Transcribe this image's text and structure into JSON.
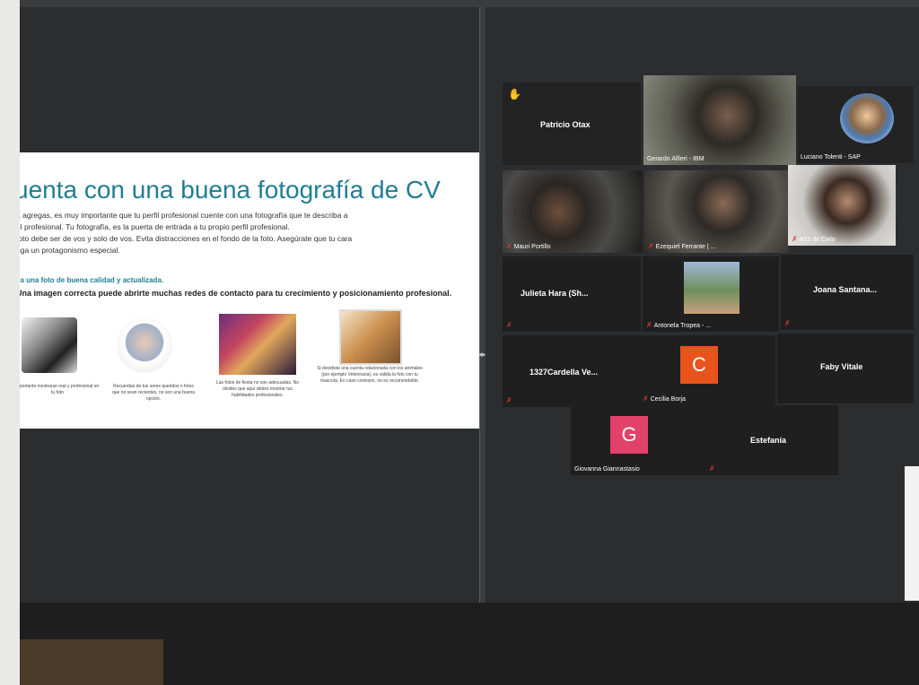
{
  "slide": {
    "title": "uenta con una buena fotografía de CV",
    "body_lines": [
      "a agregas, es muy importante que tu perfil profesional cuente con una fotografía que te describa a",
      "el profesional. Tu fotografía, es la puerta de entrada a tu propio perfil profesional.",
      "foto debe ser de vos y solo de vos. Evita distracciones en el fondo de la foto. Asegúrate que tu cara",
      "nga un protagonismo especial."
    ],
    "subheading": "sa una foto de buena calidad y actualizada.",
    "bold_line": "Una imagen correcta puede abrirte muchas redes de contacto para tu crecimiento y posicionamiento profesional.",
    "captions": [
      "mportante mostrarse real y profesional en tu foto",
      "Recuerdas de tus seres queridos o fotos que no sean recientes, no son una buena opción.",
      "Las fotos de fiesta no son adecuadas. No olvides que aquí debes mostrar tus habilidades profesionales.",
      "Si decidiste una cuenta relacionada con los animales (por ejemplo Veterinaria), es válida la foto con tu mascota. En caso contrario, no es recomendable."
    ]
  },
  "participants": [
    {
      "name": "Patricio Otax",
      "kind": "name-only",
      "hand": true
    },
    {
      "name": "Gerardo Alfieri - IBM",
      "kind": "video",
      "active": true
    },
    {
      "name": "Luciano Tolenti - SAP",
      "kind": "video"
    },
    {
      "name": "Mauri Portillo",
      "kind": "video",
      "muted": true
    },
    {
      "name": "Ezequiel Ferrante | ...",
      "kind": "video",
      "muted": true
    },
    {
      "name": "A51 de Cielo",
      "kind": "video",
      "muted": true
    },
    {
      "name": "Julieta Hara (Sh...",
      "kind": "name-only",
      "muted": true
    },
    {
      "name": "Antonela Tropea - ...",
      "kind": "video",
      "muted": true
    },
    {
      "name": "Joana Santana...",
      "kind": "name-only",
      "muted": true
    },
    {
      "name": "1327Cardella Ve...",
      "kind": "name-only",
      "muted": true
    },
    {
      "name": "Cecilia Borja",
      "kind": "avatar",
      "letter": "C",
      "color": "#e8541c",
      "muted": true
    },
    {
      "name": "Faby Vitale",
      "kind": "name-only"
    },
    {
      "name": "Giovanna Giannastasio",
      "kind": "avatar",
      "letter": "G",
      "color": "#e2416a"
    },
    {
      "name": "Estefanía",
      "kind": "name-only",
      "muted": true
    }
  ],
  "icons": {
    "hand": "raised-hand-icon",
    "mute": "muted-mic-icon"
  }
}
